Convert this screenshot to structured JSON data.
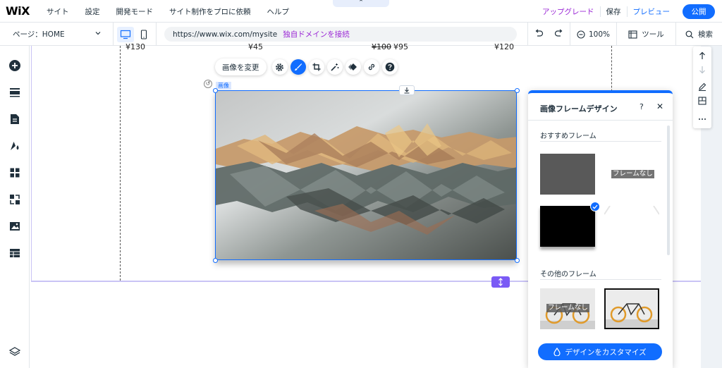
{
  "topbar": {
    "logo": "WiX",
    "menu": [
      "サイト",
      "設定",
      "開発モード",
      "サイト制作をプロに依頼",
      "ヘルプ"
    ],
    "collapse": "⌃",
    "upgrade": "アップグレード",
    "save": "保存",
    "preview": "プレビュー",
    "publish": "公開"
  },
  "subbar": {
    "page": "ページ：HOME",
    "url": "https://www.wix.com/mysite",
    "domain_link": "独自ドメインを接続",
    "zoom": "100%",
    "tools": "ツール",
    "search": "検索"
  },
  "canvas": {
    "prices": [
      {
        "text": "¥130",
        "strike": false
      },
      {
        "text": "¥45",
        "strike": false
      },
      {
        "text": "¥100",
        "strike": true
      },
      {
        "text": "¥95",
        "strike": false
      },
      {
        "text": "¥120",
        "strike": false
      }
    ],
    "image_label": "画像"
  },
  "toolbar": {
    "change_image": "画像を変更"
  },
  "panel": {
    "title": "画像フレームデザイン",
    "help": "?",
    "close": "✕",
    "recommended": "おすすめフレーム",
    "no_frame": "フレームなし",
    "others": "その他のフレーム",
    "no_frame_2": "フレームなし",
    "customize": "デザインをカスタマイズ"
  },
  "colors": {
    "accent": "#116dff",
    "upgrade": "#9a27d5",
    "section": "#7a5af5"
  }
}
